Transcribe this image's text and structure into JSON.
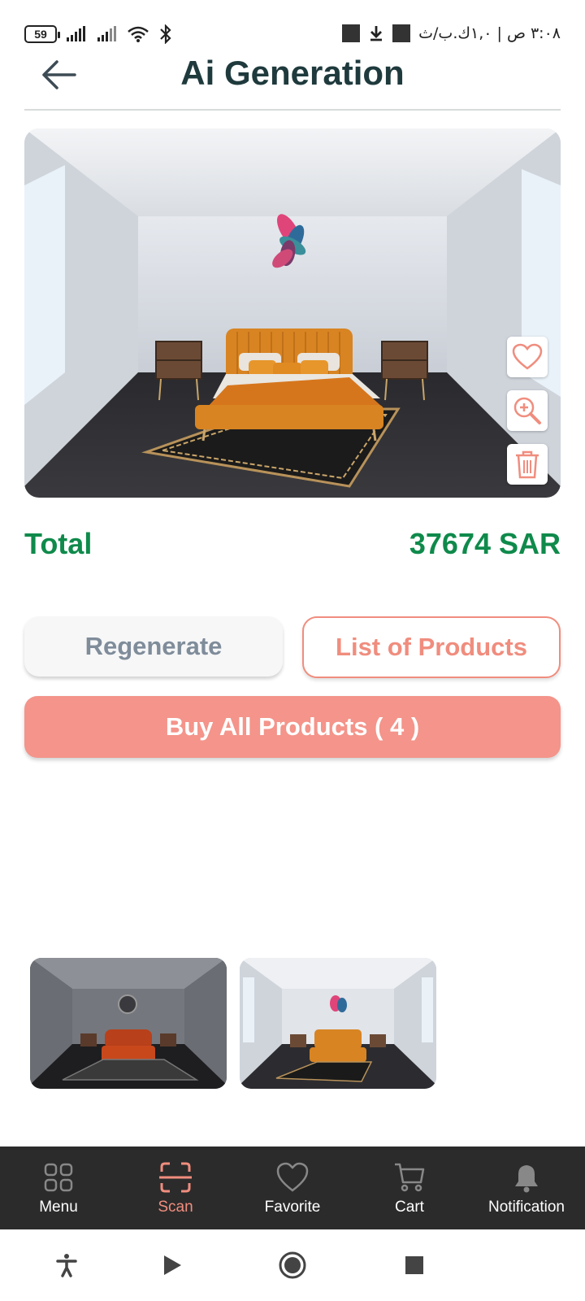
{
  "status_bar": {
    "battery": "59",
    "time_text": "٣:٠٨ ص | ١,٠ك.ب/ث"
  },
  "header": {
    "title": "Ai Generation"
  },
  "main_image": {
    "actions": [
      "heart-icon",
      "zoom-in-icon",
      "trash-icon"
    ]
  },
  "total": {
    "label": "Total",
    "value": "37674 SAR"
  },
  "buttons": {
    "regenerate": "Regenerate",
    "list_products": "List of Products",
    "buy_all": "Buy All Products ( 4 )"
  },
  "thumbnails": [
    "dark-bedroom-thumbnail",
    "light-bedroom-thumbnail"
  ],
  "bottom_nav": {
    "items": [
      {
        "label": "Menu",
        "icon": "grid-icon"
      },
      {
        "label": "Scan",
        "icon": "scan-icon"
      },
      {
        "label": "Favorite",
        "icon": "heart-icon"
      },
      {
        "label": "Cart",
        "icon": "cart-icon"
      },
      {
        "label": "Notification",
        "icon": "bell-icon"
      }
    ],
    "active": "Scan"
  },
  "colors": {
    "accent": "#f08d7e",
    "total_green": "#0f8a4b",
    "title": "#1f3a3d",
    "nav_bg": "#2b2b2b"
  }
}
